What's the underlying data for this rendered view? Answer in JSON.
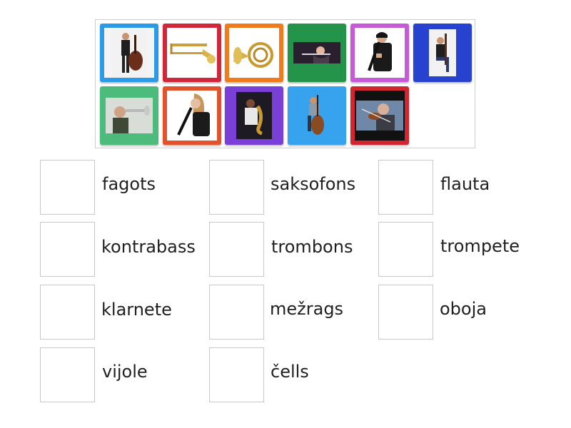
{
  "tiles": [
    {
      "icon": "double-bass-player-photo",
      "color": "#2b9be8"
    },
    {
      "icon": "trombone-photo",
      "color": "#d0273b"
    },
    {
      "icon": "french-horn-photo",
      "color": "#f07b1d"
    },
    {
      "icon": "flute-player-photo",
      "color": "#23944a"
    },
    {
      "icon": "clarinet-player-photo",
      "color": "#c75ad6"
    },
    {
      "icon": "bassoon-player-photo",
      "color": "#2742cf"
    },
    {
      "icon": "trumpet-player-photo",
      "color": "#4dbb7c"
    },
    {
      "icon": "oboe-player-photo",
      "color": "#e2522b"
    },
    {
      "icon": "saxophone-player-photo",
      "color": "#7a3fd6"
    },
    {
      "icon": "cello-player-photo",
      "color": "#37a3ee"
    },
    {
      "icon": "violin-player-photo",
      "color": "#d12532"
    }
  ],
  "targets": [
    {
      "label": "fagots"
    },
    {
      "label": "saksofons"
    },
    {
      "label": "flauta"
    },
    {
      "label": "kontrabass"
    },
    {
      "label": "trombons"
    },
    {
      "label": "trompete"
    },
    {
      "label": "klarnete"
    },
    {
      "label": "mežrags"
    },
    {
      "label": "oboja"
    },
    {
      "label": "vijole"
    },
    {
      "label": "čells"
    }
  ]
}
